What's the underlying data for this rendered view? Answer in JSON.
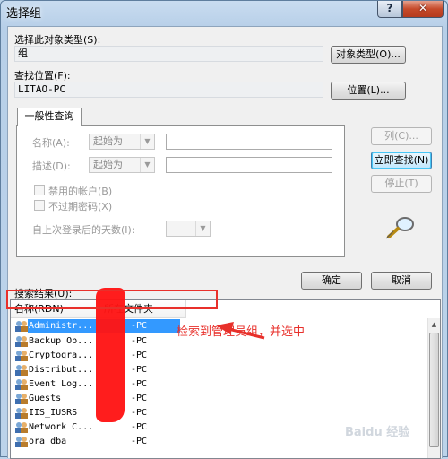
{
  "window": {
    "title": "选择组",
    "help": "?",
    "close": "✕"
  },
  "object_type": {
    "label": "选择此对象类型(S):",
    "value": "组",
    "button": "对象类型(O)..."
  },
  "location": {
    "label": "查找位置(F):",
    "value": "LITAO-PC",
    "button": "位置(L)..."
  },
  "tab": {
    "label": "一般性查询"
  },
  "query": {
    "name_label": "名称(A):",
    "name_op": "起始为",
    "desc_label": "描述(D):",
    "desc_op": "起始为",
    "disabled_accounts": "禁用的帐户(B)",
    "non_expiring_pw": "不过期密码(X)",
    "days_since_login": "自上次登录后的天数(I):"
  },
  "buttons": {
    "columns": "列(C)...",
    "find_now": "立即查找(N)",
    "stop": "停止(T)",
    "ok": "确定",
    "cancel": "取消"
  },
  "results": {
    "label": "搜索结果(U):",
    "columns": [
      "名称(RDN)",
      "所在文件夹"
    ],
    "rows": [
      {
        "name": "Administr...",
        "folder": "-PC"
      },
      {
        "name": "Backup Op...",
        "folder": "-PC"
      },
      {
        "name": "Cryptogra...",
        "folder": "-PC"
      },
      {
        "name": "Distribut...",
        "folder": "-PC"
      },
      {
        "name": "Event Log...",
        "folder": "-PC"
      },
      {
        "name": "Guests",
        "folder": "-PC"
      },
      {
        "name": "IIS_IUSRS",
        "folder": "-PC"
      },
      {
        "name": "Network C...",
        "folder": "-PC"
      },
      {
        "name": "ora_dba",
        "folder": "-PC"
      }
    ]
  },
  "annotation": {
    "text": "检索到管理员组，并选中"
  },
  "watermark": {
    "text": "Baidu 经验"
  }
}
